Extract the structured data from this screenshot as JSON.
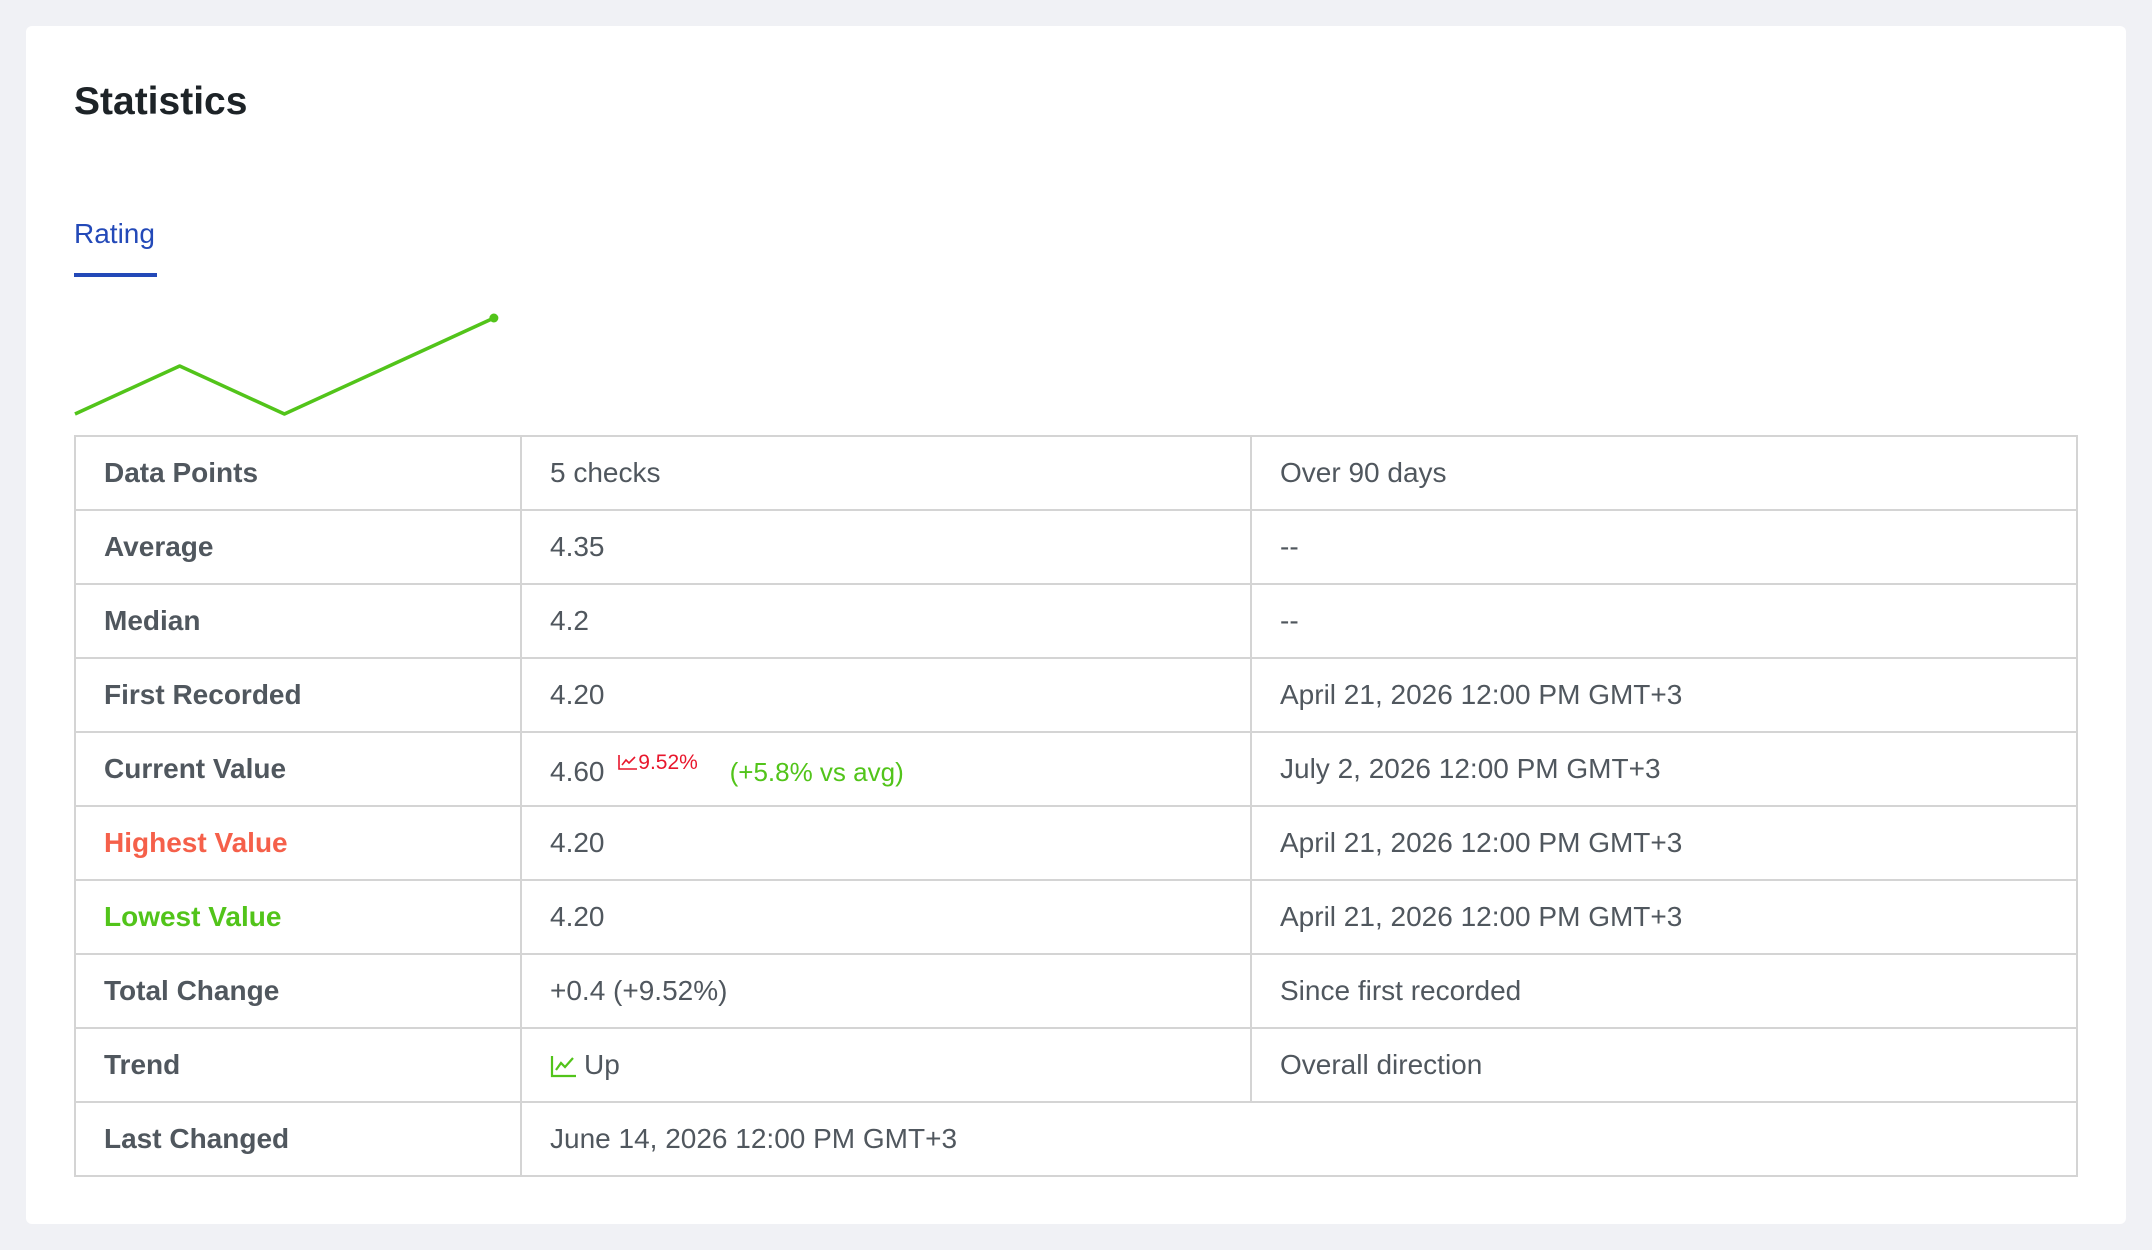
{
  "card": {
    "title": "Statistics"
  },
  "tabs": [
    {
      "label": "Rating",
      "active": true
    }
  ],
  "colors": {
    "accent": "#2349b8",
    "positive": "#52c41a",
    "negative": "#e8162c",
    "highest": "#f5604a"
  },
  "chart_data": {
    "type": "line",
    "series": [
      {
        "values": [
          4.2,
          4.4,
          4.2,
          4.4,
          4.6
        ]
      }
    ],
    "color": "#52c41a",
    "grid": false
  },
  "stats": {
    "data_points": {
      "label": "Data Points",
      "value": "5 checks",
      "note": "Over 90 days"
    },
    "average": {
      "label": "Average",
      "value": "4.35",
      "note": "--"
    },
    "median": {
      "label": "Median",
      "value": "4.2",
      "note": "--"
    },
    "first_recorded": {
      "label": "First Recorded",
      "value": "4.20",
      "note": "April 21, 2026 12:00 PM GMT+3"
    },
    "current_value": {
      "label": "Current Value",
      "value": "4.60",
      "change_pct": "9.52%",
      "change_icon": "trend-up-icon",
      "vs_avg": "(+5.8% vs avg)",
      "note": "July 2, 2026 12:00 PM GMT+3"
    },
    "highest_value": {
      "label": "Highest Value",
      "value": "4.20",
      "note": "April 21, 2026 12:00 PM GMT+3"
    },
    "lowest_value": {
      "label": "Lowest Value",
      "value": "4.20",
      "note": "April 21, 2026 12:00 PM GMT+3"
    },
    "total_change": {
      "label": "Total Change",
      "value": "+0.4 (+9.52%)",
      "note": "Since first recorded"
    },
    "trend": {
      "label": "Trend",
      "value": "Up",
      "icon": "trend-up-icon",
      "note": "Overall direction"
    },
    "last_changed": {
      "label": "Last Changed",
      "value": "June 14, 2026 12:00 PM GMT+3"
    }
  }
}
